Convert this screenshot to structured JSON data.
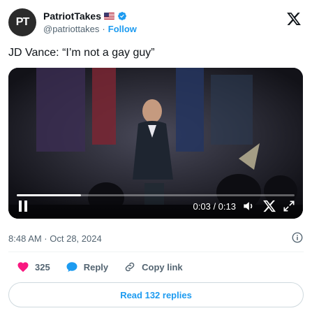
{
  "post": {
    "author_name": "PatriotTakes",
    "avatar_initials": "PT",
    "handle": "@patriottakes",
    "separator": "·",
    "follow_label": "Follow",
    "text": "JD Vance: “I’m not a gay guy”",
    "timestamp": "8:48 AM · Oct 28, 2024"
  },
  "video": {
    "time_display": "0:03 / 0:13",
    "progress_fraction": 0.23
  },
  "actions": {
    "like_count": "325",
    "reply_label": "Reply",
    "copy_link_label": "Copy link"
  },
  "footer": {
    "read_replies_label": "Read 132 replies"
  },
  "icons": {
    "verified": "verified-badge-icon",
    "flag": "us-flag-icon",
    "brand": "x-logo-icon",
    "pause": "pause-icon",
    "volume": "volume-icon",
    "x_overlay": "x-logo-icon",
    "expand": "expand-icon",
    "info": "info-icon",
    "like": "heart-icon",
    "reply": "speech-bubble-icon",
    "copy": "link-icon"
  },
  "colors": {
    "accent": "#1d9bf0",
    "like": "#f91880",
    "text_primary": "#0f1419",
    "text_secondary": "#536471"
  }
}
